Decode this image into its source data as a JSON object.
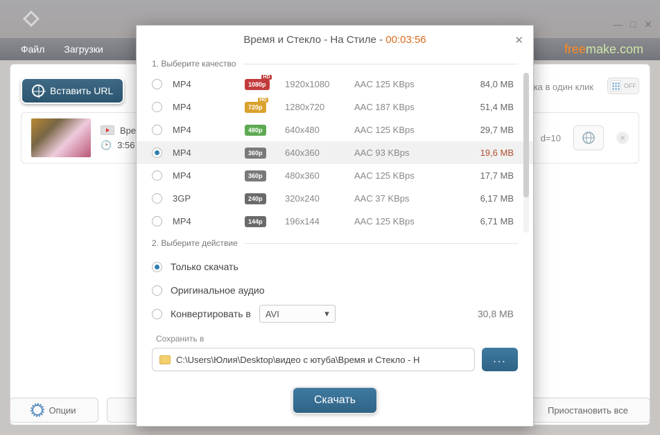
{
  "window": {
    "min": "—",
    "max": "□",
    "close": "✕"
  },
  "menu": {
    "file": "Файл",
    "downloads": "Загрузки"
  },
  "brand": {
    "free": "free",
    "rest": "make.com"
  },
  "toolbar": {
    "paste_url": "Вставить URL",
    "one_click_tail": "узка в один клик",
    "off": "OFF"
  },
  "queue": {
    "title_tail": "Время",
    "duration": "3:56",
    "url_tail": "d=10"
  },
  "footer": {
    "options": "Опции",
    "pause_all": "Приостановить все"
  },
  "modal": {
    "title": "Время и Стекло - На Стиле",
    "duration": "00:03:56",
    "sec1": "1. Выберите качество",
    "sec2": "2. Выберите действие",
    "qualities": [
      {
        "fmt": "MP4",
        "badge": "1080p",
        "bclass": "b1080",
        "hd": true,
        "res": "1920x1080",
        "codec": "AAC 125  KBps",
        "size": "84,0 MB",
        "sel": false,
        "apple": false
      },
      {
        "fmt": "MP4",
        "badge": "720p",
        "bclass": "b720",
        "hd": true,
        "res": "1280x720",
        "codec": "AAC 187  KBps",
        "size": "51,4 MB",
        "sel": false,
        "apple": false
      },
      {
        "fmt": "MP4",
        "badge": "480p",
        "bclass": "b480",
        "hd": false,
        "res": "640x480",
        "codec": "AAC 125  KBps",
        "size": "29,7 MB",
        "sel": false,
        "apple": false
      },
      {
        "fmt": "MP4",
        "badge": "360p",
        "bclass": "b360",
        "hd": false,
        "res": "640x360",
        "codec": "AAC 93  KBps",
        "size": "19,6 MB",
        "sel": true,
        "apple": true
      },
      {
        "fmt": "MP4",
        "badge": "360p",
        "bclass": "b360",
        "hd": false,
        "res": "480x360",
        "codec": "AAC 125  KBps",
        "size": "17,7 MB",
        "sel": false,
        "apple": false
      },
      {
        "fmt": "3GP",
        "badge": "240p",
        "bclass": "b240",
        "hd": false,
        "res": "320x240",
        "codec": "AAC 37  KBps",
        "size": "6,17 MB",
        "sel": false,
        "apple": false
      },
      {
        "fmt": "MP4",
        "badge": "144p",
        "bclass": "b144",
        "hd": false,
        "res": "196x144",
        "codec": "AAC 125  KBps",
        "size": "6,71 MB",
        "sel": false,
        "apple": false
      }
    ],
    "actions": {
      "download_only": "Только скачать",
      "original_audio": "Оригинальное аудио",
      "convert_to": "Конвертировать в",
      "conv_format": "AVI",
      "conv_size": "30,8 MB"
    },
    "save": {
      "label": "Сохранить в",
      "path": "C:\\Users\\Юлия\\Desktop\\видео с ютуба\\Время и Стекло - Н",
      "browse": "..."
    },
    "download_btn": "Скачать"
  }
}
